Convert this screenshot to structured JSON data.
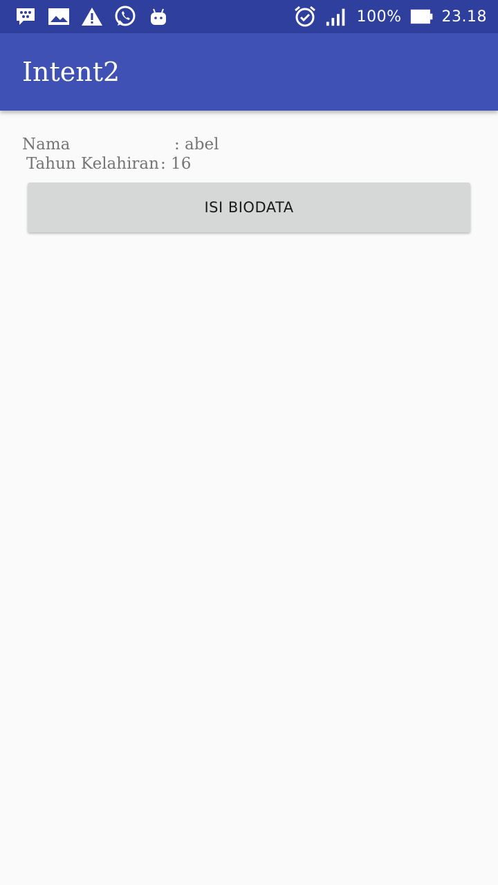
{
  "status_bar": {
    "left_icons": [
      "bbm-icon",
      "gallery-icon",
      "warning-icon",
      "whatsapp-icon",
      "android-icon"
    ],
    "right_icons": [
      "alarm-icon",
      "signal-icon",
      "battery-icon"
    ],
    "battery_percent": "100%",
    "time": "23.18"
  },
  "app_bar": {
    "title": "Intent2",
    "color": "#3f51b5"
  },
  "content": {
    "nama_label": "Nama",
    "nama_value": ": abel",
    "tahun_label": "Tahun Kelahiran",
    "tahun_value": ": 16",
    "button_label": "ISI BIODATA"
  }
}
